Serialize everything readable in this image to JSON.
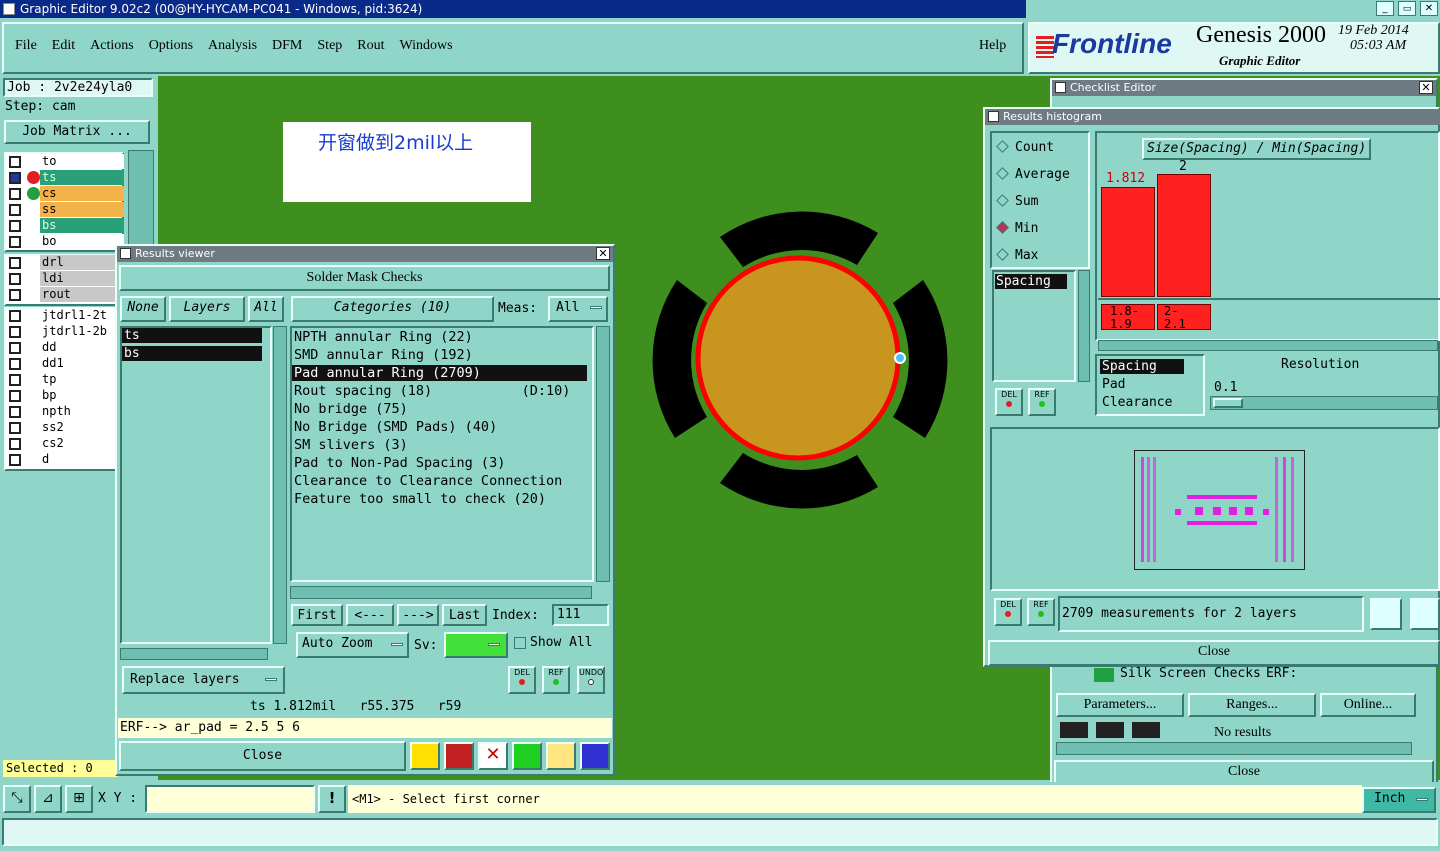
{
  "window_title": "Graphic Editor 9.02c2 (00@HY-HYCAM-PC041 - Windows, pid:3624)",
  "menu": [
    "File",
    "Edit",
    "Actions",
    "Options",
    "Analysis",
    "DFM",
    "Step",
    "Rout",
    "Windows"
  ],
  "help_label": "Help",
  "brand": {
    "logo": "Frontline",
    "product": "Genesis 2000",
    "subtitle": "Graphic Editor",
    "date": "19 Feb 2014",
    "time": "05:03 AM"
  },
  "job": {
    "job_label": "Job : 2v2e24yla0",
    "step_label": "Step: cam",
    "matrix_button": "Job Matrix ..."
  },
  "layers_group1": [
    "to",
    "ts",
    "cs",
    "ss",
    "bs",
    "bo"
  ],
  "layers_group2": [
    "drl",
    "ldi",
    "rout"
  ],
  "layers_group3": [
    "jtdrl1-2t",
    "jtdrl1-2b",
    "dd",
    "dd1",
    "tp",
    "bp",
    "npth",
    "ss2",
    "cs2",
    "d"
  ],
  "selected_label": "Selected : 0",
  "canvas_note": "开窗做到2mil以上",
  "results_viewer": {
    "title": "Results viewer",
    "header": "Solder Mask Checks",
    "none_btn": "None",
    "layers_btn": "Layers",
    "all_btn": "All",
    "categories_btn": "Categories (10)",
    "meas_label": "Meas:",
    "meas_value": "All",
    "layers": [
      "ts",
      "bs"
    ],
    "categories": [
      "NPTH annular Ring (22)",
      "SMD annular Ring (192)",
      "Pad annular Ring (2709)",
      "Rout spacing (18)           (D:10)",
      "No bridge (75)",
      "No Bridge (SMD Pads) (40)",
      "SM slivers (3)",
      "Pad to Non-Pad Spacing (3)",
      "Clearance to Clearance Connection",
      "Feature too small to check (20)"
    ],
    "first_btn": "First",
    "prev_btn": "<---",
    "next_btn": "--->",
    "last_btn": "Last",
    "index_label": "Index:",
    "index_value": "111",
    "auto_zoom": "Auto Zoom",
    "sv_label": "Sv:",
    "show_all": "Show All",
    "replace_layers": "Replace layers",
    "del": "DEL",
    "ref": "REF",
    "undo": "UNDO",
    "status_line": "ts 1.812mil   r55.375   r59",
    "erf_line": "ERF--> ar_pad = 2.5 5 6",
    "close": "Close"
  },
  "histogram": {
    "title": "Results histogram",
    "options": [
      "Count",
      "Average",
      "Sum",
      "Min",
      "Max"
    ],
    "selected_option": "Min",
    "chart_title": "Size(Spacing) / Min(Spacing)",
    "bar1_label": "1.812",
    "bar2_label": "2",
    "bin1": "1.8-\n1.9",
    "bin2": "2-\n2.1",
    "list1": [
      "Spacing"
    ],
    "list2": [
      "Spacing",
      "Pad",
      "Clearance"
    ],
    "resolution_label": "Resolution",
    "resolution_value": "0.1",
    "del": "DEL",
    "ref": "REF",
    "measurements": "2709 measurements for 2 layers",
    "close": "Close"
  },
  "checklist": {
    "title": "Checklist Editor",
    "silk_label": "Silk Screen Checks",
    "erf_label": "ERF:",
    "parameters": "Parameters...",
    "ranges": "Ranges...",
    "online": "Online...",
    "no_results": "No results",
    "close": "Close"
  },
  "bottom": {
    "xy_label": "X Y :",
    "prompt": "<M1> - Select first corner",
    "units": "Inch"
  },
  "colors": {
    "canvas": "#3f8f1e",
    "panel": "#8fd6c9",
    "accent_red": "#ff0000",
    "pad": "#c8961e"
  }
}
